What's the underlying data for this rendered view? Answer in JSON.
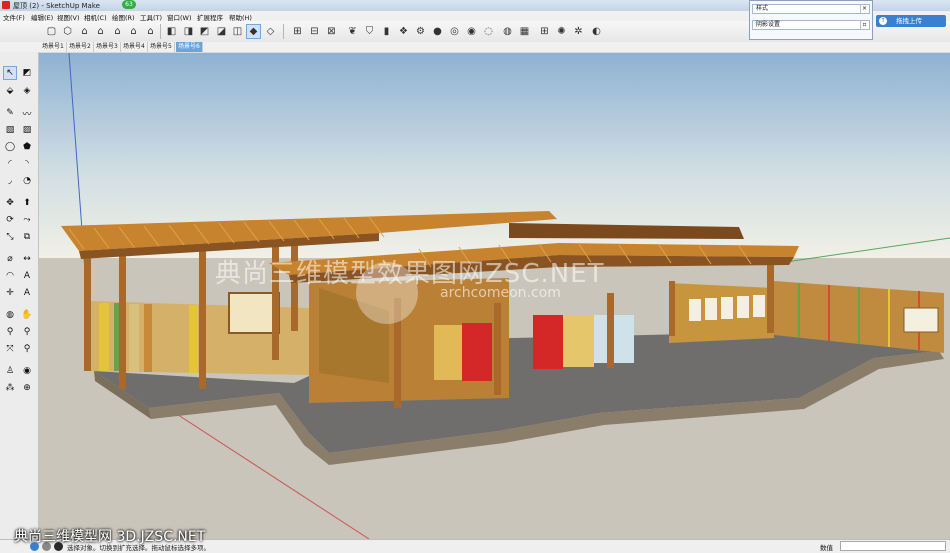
{
  "window": {
    "title": "屋顶 (2) - SketchUp Make",
    "badge": "63"
  },
  "menu": [
    "文件(F)",
    "编辑(E)",
    "视图(V)",
    "相机(C)",
    "绘图(R)",
    "工具(T)",
    "窗口(W)",
    "扩展程序",
    "帮助(H)"
  ],
  "scene_tabs": [
    "场景号1",
    "场景号2",
    "场景号3",
    "场景号4",
    "场景号5",
    "场景号6"
  ],
  "active_tab": "场景号6",
  "tray": {
    "style_label": "样式",
    "shadow_label": "阴影设置"
  },
  "upload_button": "拖拽上传",
  "status": {
    "hint": "选择对象。切换到扩充选择。拖动鼠标选择多项。",
    "vcb_label": "数值"
  },
  "watermark": {
    "line1": "典尚三维模型效果图网ZSC.NET",
    "line2": "archcomeon.com",
    "footer": "典尚三维模型网 3D.JZSC.NET"
  },
  "colors": {
    "sky_top": "#8eb2d2",
    "sky_bottom": "#f3f1e6",
    "ground": "#c9c5ba",
    "wood": "#c7832d"
  }
}
